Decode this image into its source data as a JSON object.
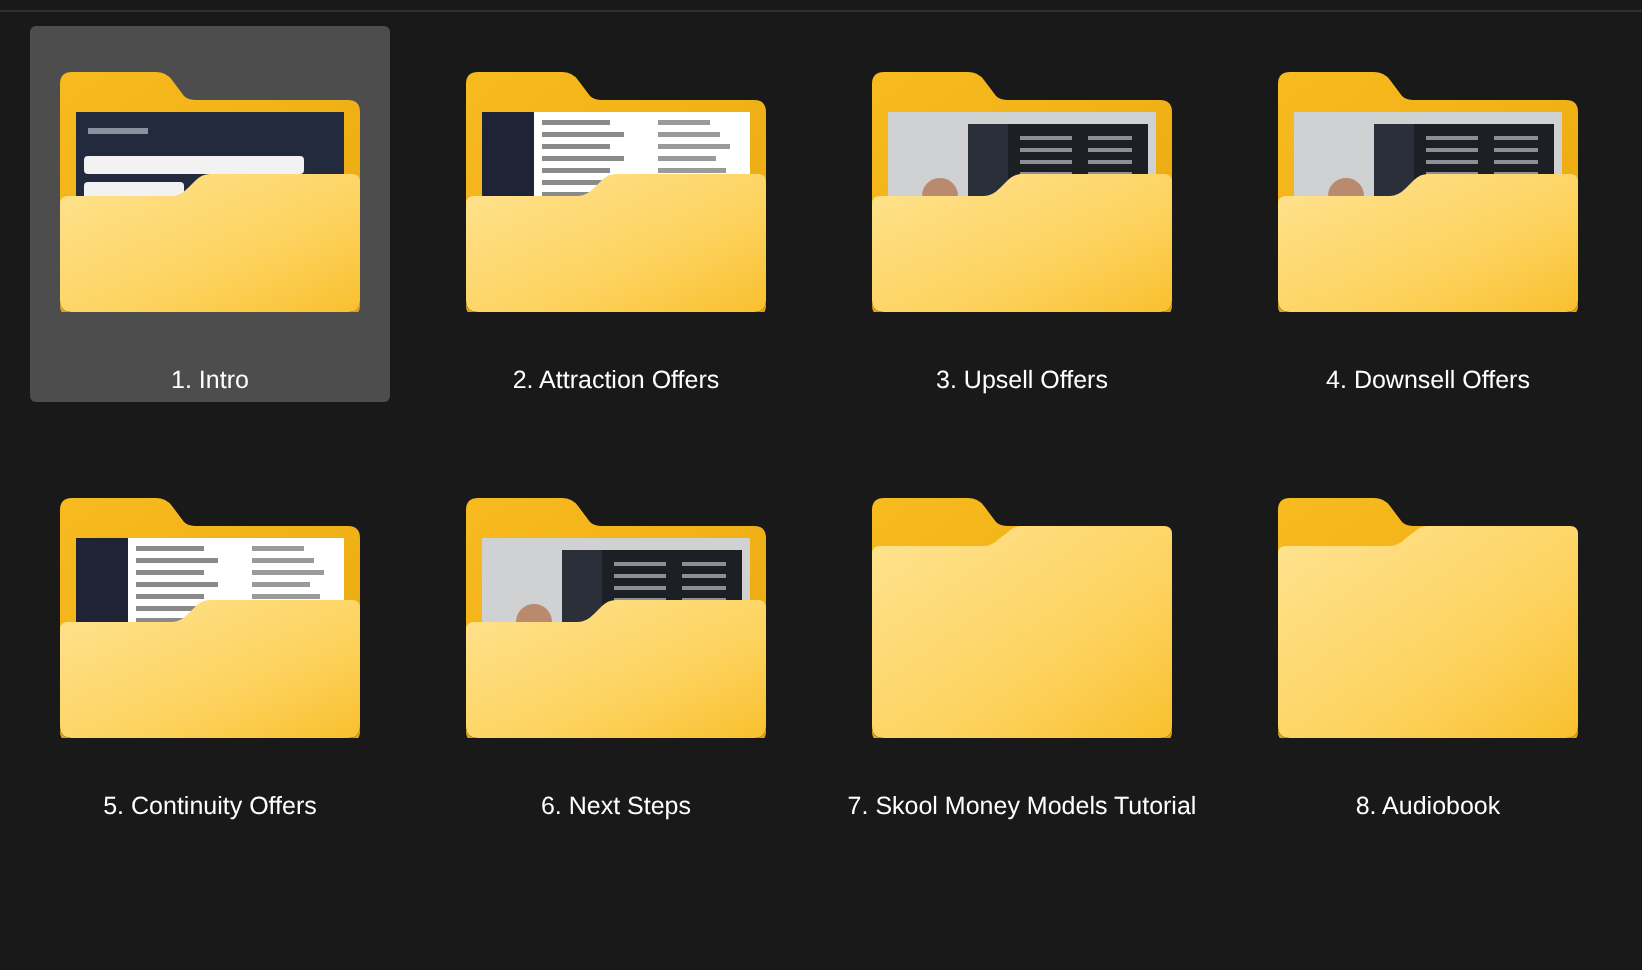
{
  "folders": [
    {
      "name": "1. Intro",
      "selected": true,
      "kind": "picture"
    },
    {
      "name": "2. Attraction Offers",
      "selected": false,
      "kind": "picture"
    },
    {
      "name": "3. Upsell Offers",
      "selected": false,
      "kind": "picture"
    },
    {
      "name": "4. Downsell Offers",
      "selected": false,
      "kind": "picture"
    },
    {
      "name": "5. Continuity Offers",
      "selected": false,
      "kind": "picture"
    },
    {
      "name": "6. Next Steps",
      "selected": false,
      "kind": "picture"
    },
    {
      "name": "7. Skool Money Models Tutorial",
      "selected": false,
      "kind": "empty"
    },
    {
      "name": "8. Audiobook",
      "selected": false,
      "kind": "empty"
    }
  ]
}
